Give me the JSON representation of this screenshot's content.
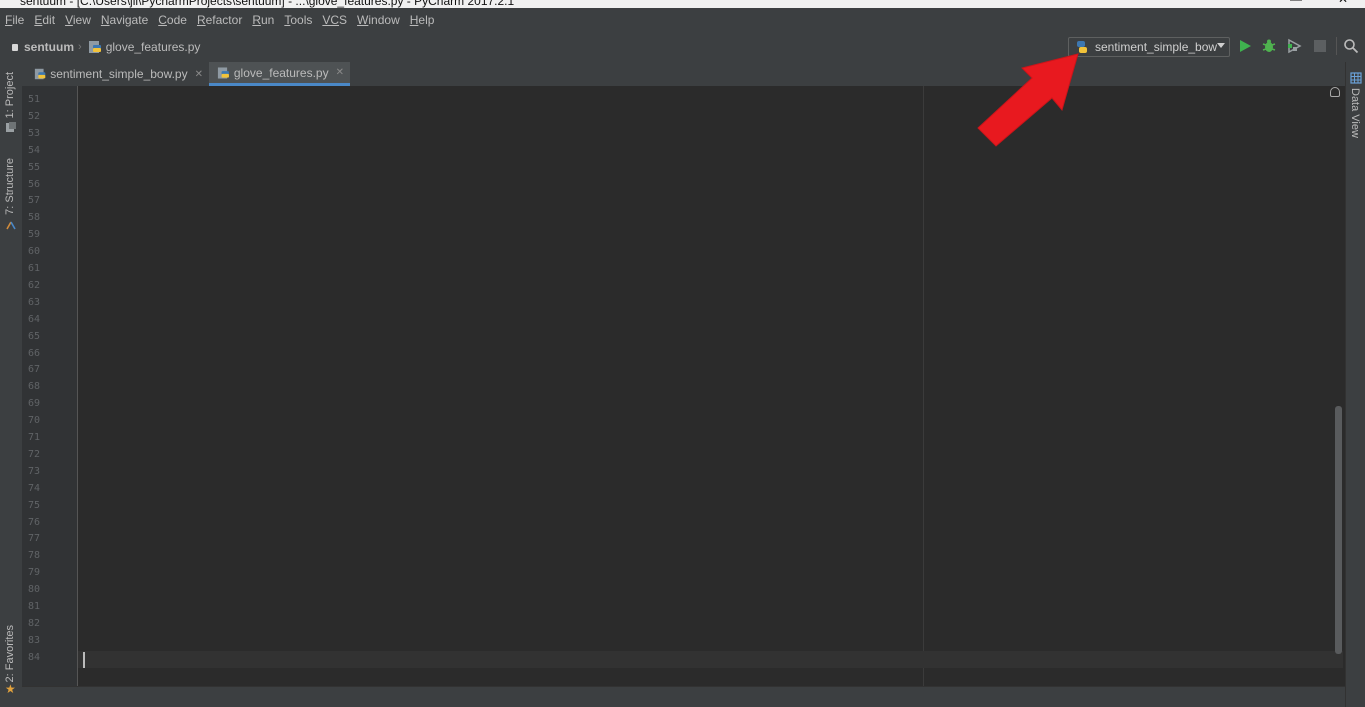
{
  "window": {
    "title": "sentuum - [C:\\Users\\jil\\PycharmProjects\\sentuum] - ...\\glove_features.py - PyCharm 2017.2.1"
  },
  "menu": [
    {
      "mnemonic": "F",
      "rest": "ile"
    },
    {
      "mnemonic": "E",
      "rest": "dit"
    },
    {
      "mnemonic": "V",
      "rest": "iew"
    },
    {
      "mnemonic": "N",
      "rest": "avigate"
    },
    {
      "mnemonic": "C",
      "rest": "ode"
    },
    {
      "mnemonic": "R",
      "rest": "efactor"
    },
    {
      "mnemonic": "R",
      "rest": "un"
    },
    {
      "mnemonic": "T",
      "rest": "ools"
    },
    {
      "mnemonic": "VC",
      "rest": "S"
    },
    {
      "mnemonic": "W",
      "rest": "indow"
    },
    {
      "mnemonic": "H",
      "rest": "elp"
    }
  ],
  "breadcrumb": {
    "project": "sentuum",
    "file": "glove_features.py"
  },
  "run_config": {
    "selected": "sentiment_simple_bow",
    "icon": "python-icon"
  },
  "toolbar": {
    "run_icon": "run-icon",
    "debug_icon": "debug-icon",
    "coverage_icon": "coverage-icon",
    "stop_icon": "stop-icon",
    "search_icon": "search-icon"
  },
  "left_tools": {
    "project": "1: Project",
    "structure": "7: Structure",
    "favorites": "2: Favorites"
  },
  "right_tools": {
    "data_view": "Data View"
  },
  "tabs": [
    {
      "label": "sentiment_simple_bow.py",
      "active": false
    },
    {
      "label": "glove_features.py",
      "active": true
    }
  ],
  "editor": {
    "line_numbers": [
      "51",
      "52",
      "53",
      "54",
      "55",
      "56",
      "57",
      "58",
      "59",
      "60",
      "61",
      "62",
      "63",
      "64",
      "65",
      "66",
      "67",
      "68",
      "69",
      "70",
      "71",
      "72",
      "73",
      "74",
      "75",
      "76",
      "77",
      "78",
      "79",
      "80",
      "81",
      "82",
      "83",
      "84"
    ]
  },
  "colors": {
    "editor_bg": "#2b2b2b",
    "panel_bg": "#3c3f41",
    "annotation_arrow": "#e8191f",
    "run_green": "#3fb34f"
  }
}
